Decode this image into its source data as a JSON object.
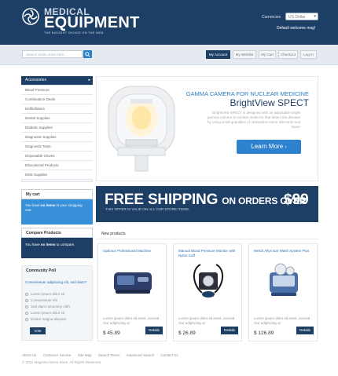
{
  "header": {
    "logo_small": "MEDICAL",
    "logo_big": "EQUIPMENT",
    "tagline": "THE BIGGEST CHOICE ON THE WEB",
    "currencies_label": "Currencies",
    "currency_value": "US Dollar",
    "welcome": "Default welcome msg!",
    "background_color": "#1d3f66"
  },
  "search": {
    "placeholder": "Search entire store here...",
    "button_icon": "search-icon"
  },
  "top_nav": [
    "My Account",
    "My Wishlist",
    "My Cart",
    "Checkout",
    "Log In"
  ],
  "categories": {
    "heading": "Accessories",
    "items": [
      "Blood Pressure",
      "Combination Deals",
      "Defibrillators",
      "Dental Supplies",
      "Diabetic Supplies",
      "Diagnostic Supplies",
      "Diagnostic Tests",
      "Disposable Gloves",
      "Educational Products",
      "EMS Supplies"
    ]
  },
  "cart": {
    "heading": "My cart",
    "text_before": "You have",
    "bold": "no items",
    "text_after": "in your shopping cart."
  },
  "compare": {
    "heading": "Compare Products",
    "text_before": "You have",
    "bold": "no items",
    "text_after": "to compare."
  },
  "poll": {
    "heading": "Community Poll",
    "question": "Consectetuer adipiscing elit, sed diam?",
    "options": [
      "Lorem ipsum dolor sit",
      "Consectetuer elit",
      "Sed diam nonummy nibh",
      "Lorem ipsum dolor sit",
      "Dolore magna aliquam"
    ],
    "vote_label": "Vote"
  },
  "banner": {
    "kicker": "GAMMA CAMERA FOR NUCLEAR MEDICINE",
    "title": "BrightView SPECT",
    "text": "BrightView SPECT is designed with an adjustable single gamma camera to nuclear medicine that detect the disease by using small quantities of radioactive tracer elements and tracer",
    "button": "Learn More",
    "button_icon": "chevron-right-icon"
  },
  "shipping": {
    "free": "FREE SHIPPING",
    "rest": "ON ORDERS OVER",
    "price": "$99",
    "note": "THIS OFFER IS VALID ON ALL OUR STORE ITEMS."
  },
  "new_products": {
    "heading": "New products",
    "items": [
      {
        "name": "Optimus Professional Machine",
        "desc": "Lorem ipsum dolor sit amet, conced ctur adipiscing ut.",
        "price": "$ 45.89",
        "button": "Details"
      },
      {
        "name": "Manual Blood Pressure Monitor with Nylon Cuff",
        "desc": "Lorem ipsum dolor sit amet, conced ctur adipiscing ut.",
        "price": "$ 26.89",
        "button": "Details"
      },
      {
        "name": "Welch Allyn Ear Wash System Plus",
        "desc": "Lorem ipsum dolor sit amet, conced ctur adipiscing ut.",
        "price": "$ 126.89",
        "button": "Details"
      }
    ]
  },
  "footer": {
    "links": [
      "About Us",
      "Customer Service",
      "Site Map",
      "Search Terms",
      "Advanced Search",
      "Contact Us"
    ],
    "copyright": "© 2011 Magento Demo Store. All Rights Reserved."
  }
}
